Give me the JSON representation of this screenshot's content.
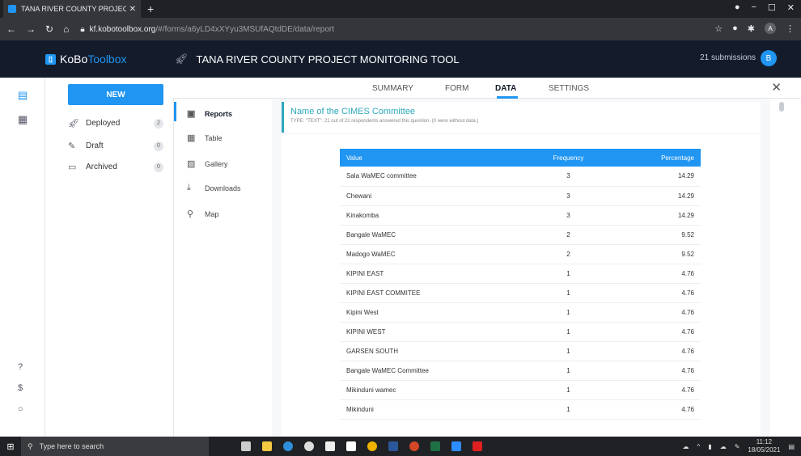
{
  "browser": {
    "tab_title": "TANA RIVER COUNTY PROJECT M",
    "url_host": "kf.kobotoolbox.org",
    "url_path": "/#/forms/a6yLD4xXYyu3MSUfAQtdDE/data/report",
    "profile_initial": "A"
  },
  "header": {
    "logo_ko": "KoBo",
    "logo_tb": "Toolbox",
    "project_title": "TANA RIVER COUNTY PROJECT MONITORING TOOL",
    "submissions": "21 submissions",
    "user_initial": "B"
  },
  "sidebar": {
    "new_label": "NEW",
    "items": [
      {
        "label": "Deployed",
        "count": "2"
      },
      {
        "label": "Draft",
        "count": "0"
      },
      {
        "label": "Archived",
        "count": "0"
      }
    ]
  },
  "tabs": [
    "SUMMARY",
    "FORM",
    "DATA",
    "SETTINGS"
  ],
  "report_nav": [
    "Reports",
    "Table",
    "Gallery",
    "Downloads",
    "Map"
  ],
  "question": {
    "title": "Name of the CIMES Committee",
    "meta": "TYPE: \"TEXT\". 21 out of 21 respondents answered this question. (0 were without data.)"
  },
  "table": {
    "headers": [
      "Value",
      "Frequency",
      "Percentage"
    ],
    "rows": [
      [
        "Sala WaMEC committee",
        "3",
        "14.29"
      ],
      [
        "Chewani",
        "3",
        "14.29"
      ],
      [
        "Kinakomba",
        "3",
        "14.29"
      ],
      [
        "Bangale WaMEC",
        "2",
        "9.52"
      ],
      [
        "Madogo WaMEC",
        "2",
        "9.52"
      ],
      [
        "KIPINI EAST",
        "1",
        "4.76"
      ],
      [
        "KIPINI EAST COMMITEE",
        "1",
        "4.76"
      ],
      [
        "Kipini West",
        "1",
        "4.76"
      ],
      [
        "KIPINI WEST",
        "1",
        "4.76"
      ],
      [
        "GARSEN SOUTH",
        "1",
        "4.76"
      ],
      [
        "Bangale WaMEC Committee",
        "1",
        "4.76"
      ],
      [
        "Mikinduni wamec",
        "1",
        "4.76"
      ],
      [
        "Mikinduni",
        "1",
        "4.76"
      ]
    ]
  },
  "taskbar": {
    "search_placeholder": "Type here to search",
    "time": "11:12",
    "date": "18/05/2021"
  },
  "colors": {
    "accent": "#2095f2",
    "topbar": "#141c2c",
    "question": "#2ba9bb"
  }
}
